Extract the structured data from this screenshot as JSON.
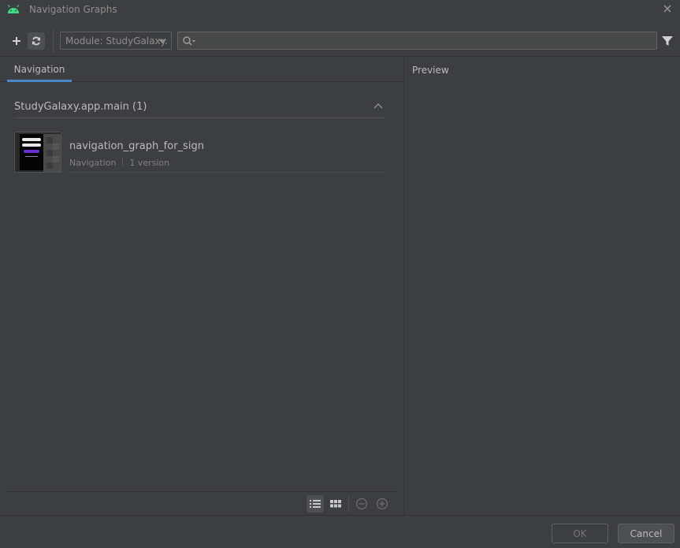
{
  "window": {
    "title": "Navigation Graphs",
    "icons": {
      "app": "android-icon",
      "close": "close-icon"
    }
  },
  "toolbar": {
    "module_select": "Module: StudyGalaxy.",
    "search": {
      "value": "",
      "placeholder": ""
    },
    "icons": {
      "add": "plus-icon",
      "refresh": "refresh-icon",
      "search": "search-icon",
      "filter": "filter-icon"
    }
  },
  "left_pane": {
    "tabs": [
      {
        "label": "Navigation",
        "selected": true
      }
    ],
    "group": {
      "title": "StudyGalaxy.app.main (1)",
      "expanded": true
    },
    "resources": [
      {
        "name": "navigation_graph_for_sign",
        "type": "Navigation",
        "versions": "1 version"
      }
    ],
    "bottom_icons": {
      "list": "list-view-icon",
      "grid": "grid-view-icon",
      "zoom_out": "zoom-out-icon",
      "zoom_in": "zoom-in-icon"
    }
  },
  "right_pane": {
    "label": "Preview"
  },
  "footer": {
    "ok_label": "OK",
    "cancel_label": "Cancel"
  },
  "colors": {
    "background": "#3c3f41",
    "accent": "#4a88c7",
    "android_green": "#3ddc84"
  }
}
